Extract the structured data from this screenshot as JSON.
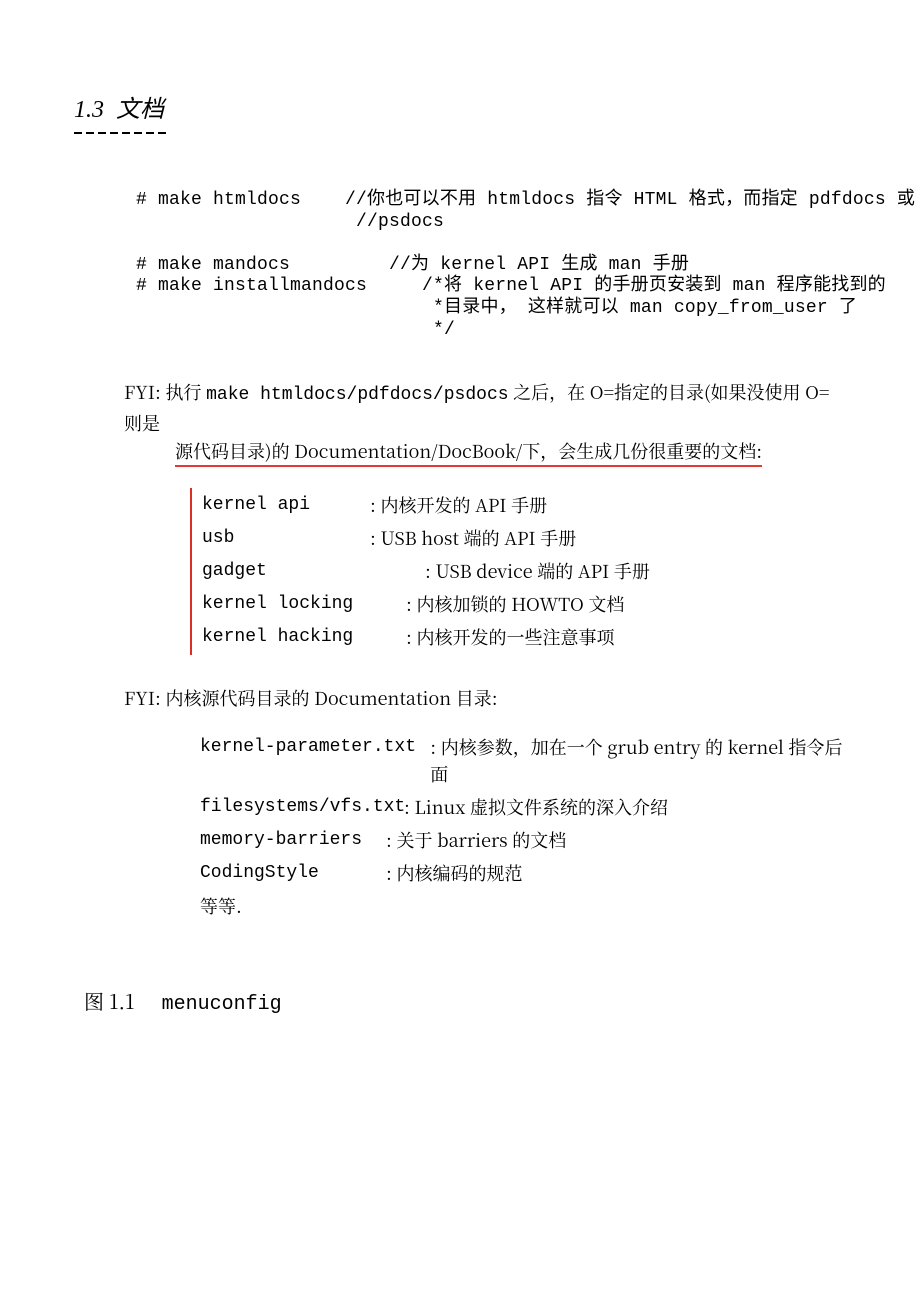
{
  "section": {
    "number": "1.3",
    "title": "文档"
  },
  "code": "# make htmldocs    //你也可以不用 htmldocs 指令 HTML 格式，而指定 pdfdocs 或\n                    //psdocs\n\n# make mandocs         //为 kernel API 生成 man 手册\n# make installmandocs     /*将 kernel API 的手册页安装到 man 程序能找到的\n                           *目录中， 这样就可以 man copy_from_user 了\n                           */",
  "fyi1": {
    "prefix": "FYI:",
    "line1_a": "执行 ",
    "line1_mono": "make htmldocs/pdfdocs/psdocs",
    "line1_b": " 之后，在 O=指定的目录(如果没使用 O=则是",
    "line2_a": "源代码目录)",
    "line2_b": "的 Documentation/DocBook/下，会生成几份很重要的文档:"
  },
  "doclist1": {
    "a_name": "kernel api",
    "a_desc": ": 内核开发的 API 手册",
    "b_name": "usb",
    "b_desc": ": USB host 端的 API 手册",
    "c_name": "gadget",
    "c_desc": ": USB device 端的 API 手册",
    "d_name": "kernel locking",
    "d_desc": ": 内核加锁的 HOWTO 文档",
    "e_name": "kernel hacking",
    "e_desc": ": 内核开发的一些注意事项"
  },
  "fyi2": {
    "prefix": "FYI:",
    "text": "内核源代码目录的 Documentation 目录:"
  },
  "doclist2": {
    "a_name": "kernel-parameter.txt",
    "a_desc": ": 内核参数，加在一个 grub entry 的 kernel 指令后面",
    "b_name": "filesystems/vfs.txt",
    "b_desc": ": Linux 虚拟文件系统的深入介绍",
    "c_name": "memory-barriers",
    "c_desc": ": 关于 barriers 的文档",
    "d_name": "CodingStyle",
    "d_desc": ": 内核编码的规范",
    "etc": "等等."
  },
  "figure": {
    "label": "图 1.1",
    "name": "menuconfig"
  }
}
